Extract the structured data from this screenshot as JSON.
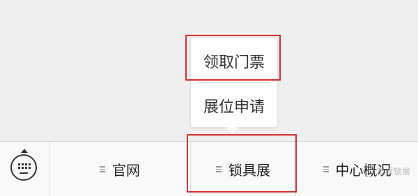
{
  "submenu": {
    "items": [
      {
        "label": "领取门票"
      },
      {
        "label": "展位申请"
      }
    ]
  },
  "menubar": {
    "keyboard_icon": "keyboard-icon",
    "tabs": [
      {
        "label": "官网",
        "icon": "menu-list-icon"
      },
      {
        "label": "锁具展",
        "icon": "menu-list-icon"
      },
      {
        "label": "中心概况",
        "icon": "menu-list-icon"
      }
    ]
  },
  "watermark": {
    "text": "智看锁展"
  },
  "colors": {
    "highlight": "#d32f2f",
    "background": "#efefef",
    "menubar": "#f9f9f9"
  }
}
